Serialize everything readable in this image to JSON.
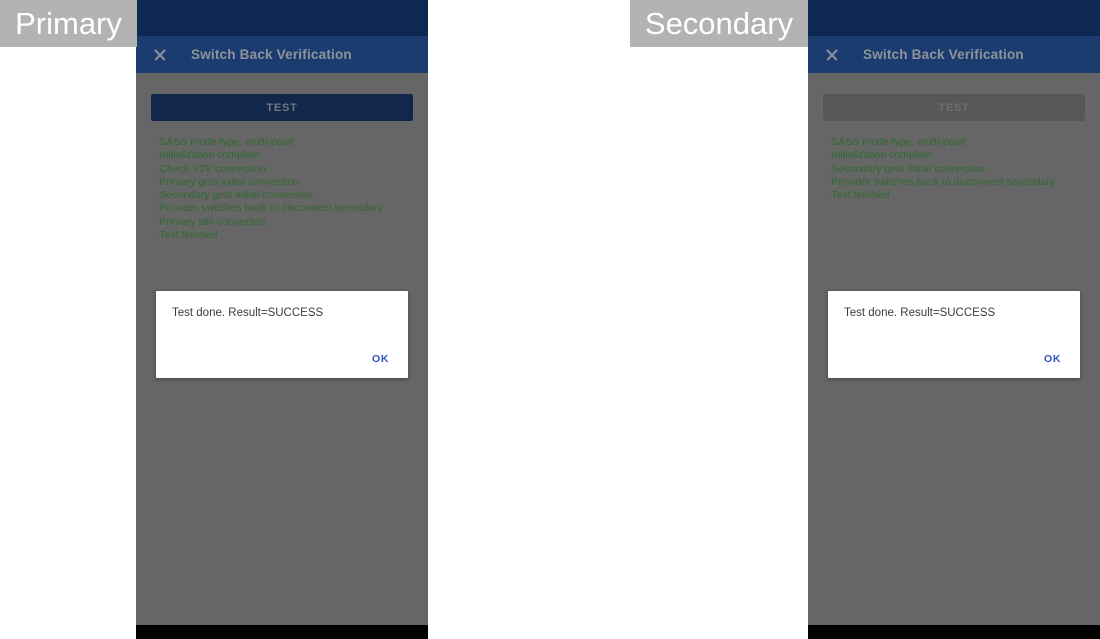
{
  "labels": {
    "primary": "Primary",
    "secondary": "Secondary"
  },
  "colors": {
    "status_bar": "#0d2853",
    "app_bar": "#1a3c6e",
    "scrim": "#666666",
    "log_text": "#2f6a2f",
    "button_enabled": "#11274b",
    "button_disabled": "#575757",
    "dialog_action": "#2a56c6",
    "label_chip": "#b3b3b3",
    "nav_bar": "#000000"
  },
  "primary": {
    "appbar": {
      "close_icon": "close-icon",
      "title": "Switch Back Verification"
    },
    "test_button": {
      "label": "TEST",
      "state": "enabled"
    },
    "log_lines": [
      "- SASS mode type: multi-point",
      "- Initialization complete",
      "- Check V2V connection.",
      "- Primary gets initial connection",
      "- Secondary gets initial connection",
      "- Provider switches back to disconnect secondary",
      "- Primary still connected.",
      "- Test finished"
    ],
    "dialog": {
      "message": "Test done. Result=SUCCESS",
      "ok_label": "OK"
    }
  },
  "secondary": {
    "appbar": {
      "close_icon": "close-icon",
      "title": "Switch Back Verification"
    },
    "test_button": {
      "label": "TEST",
      "state": "disabled"
    },
    "log_lines": [
      "- SASS mode type: multi-point",
      "- Initialization complete",
      "- Secondary gets initial connection",
      "- Provider switches back to disconnect secondary",
      "- Test finished"
    ],
    "dialog": {
      "message": "Test done. Result=SUCCESS",
      "ok_label": "OK"
    }
  }
}
